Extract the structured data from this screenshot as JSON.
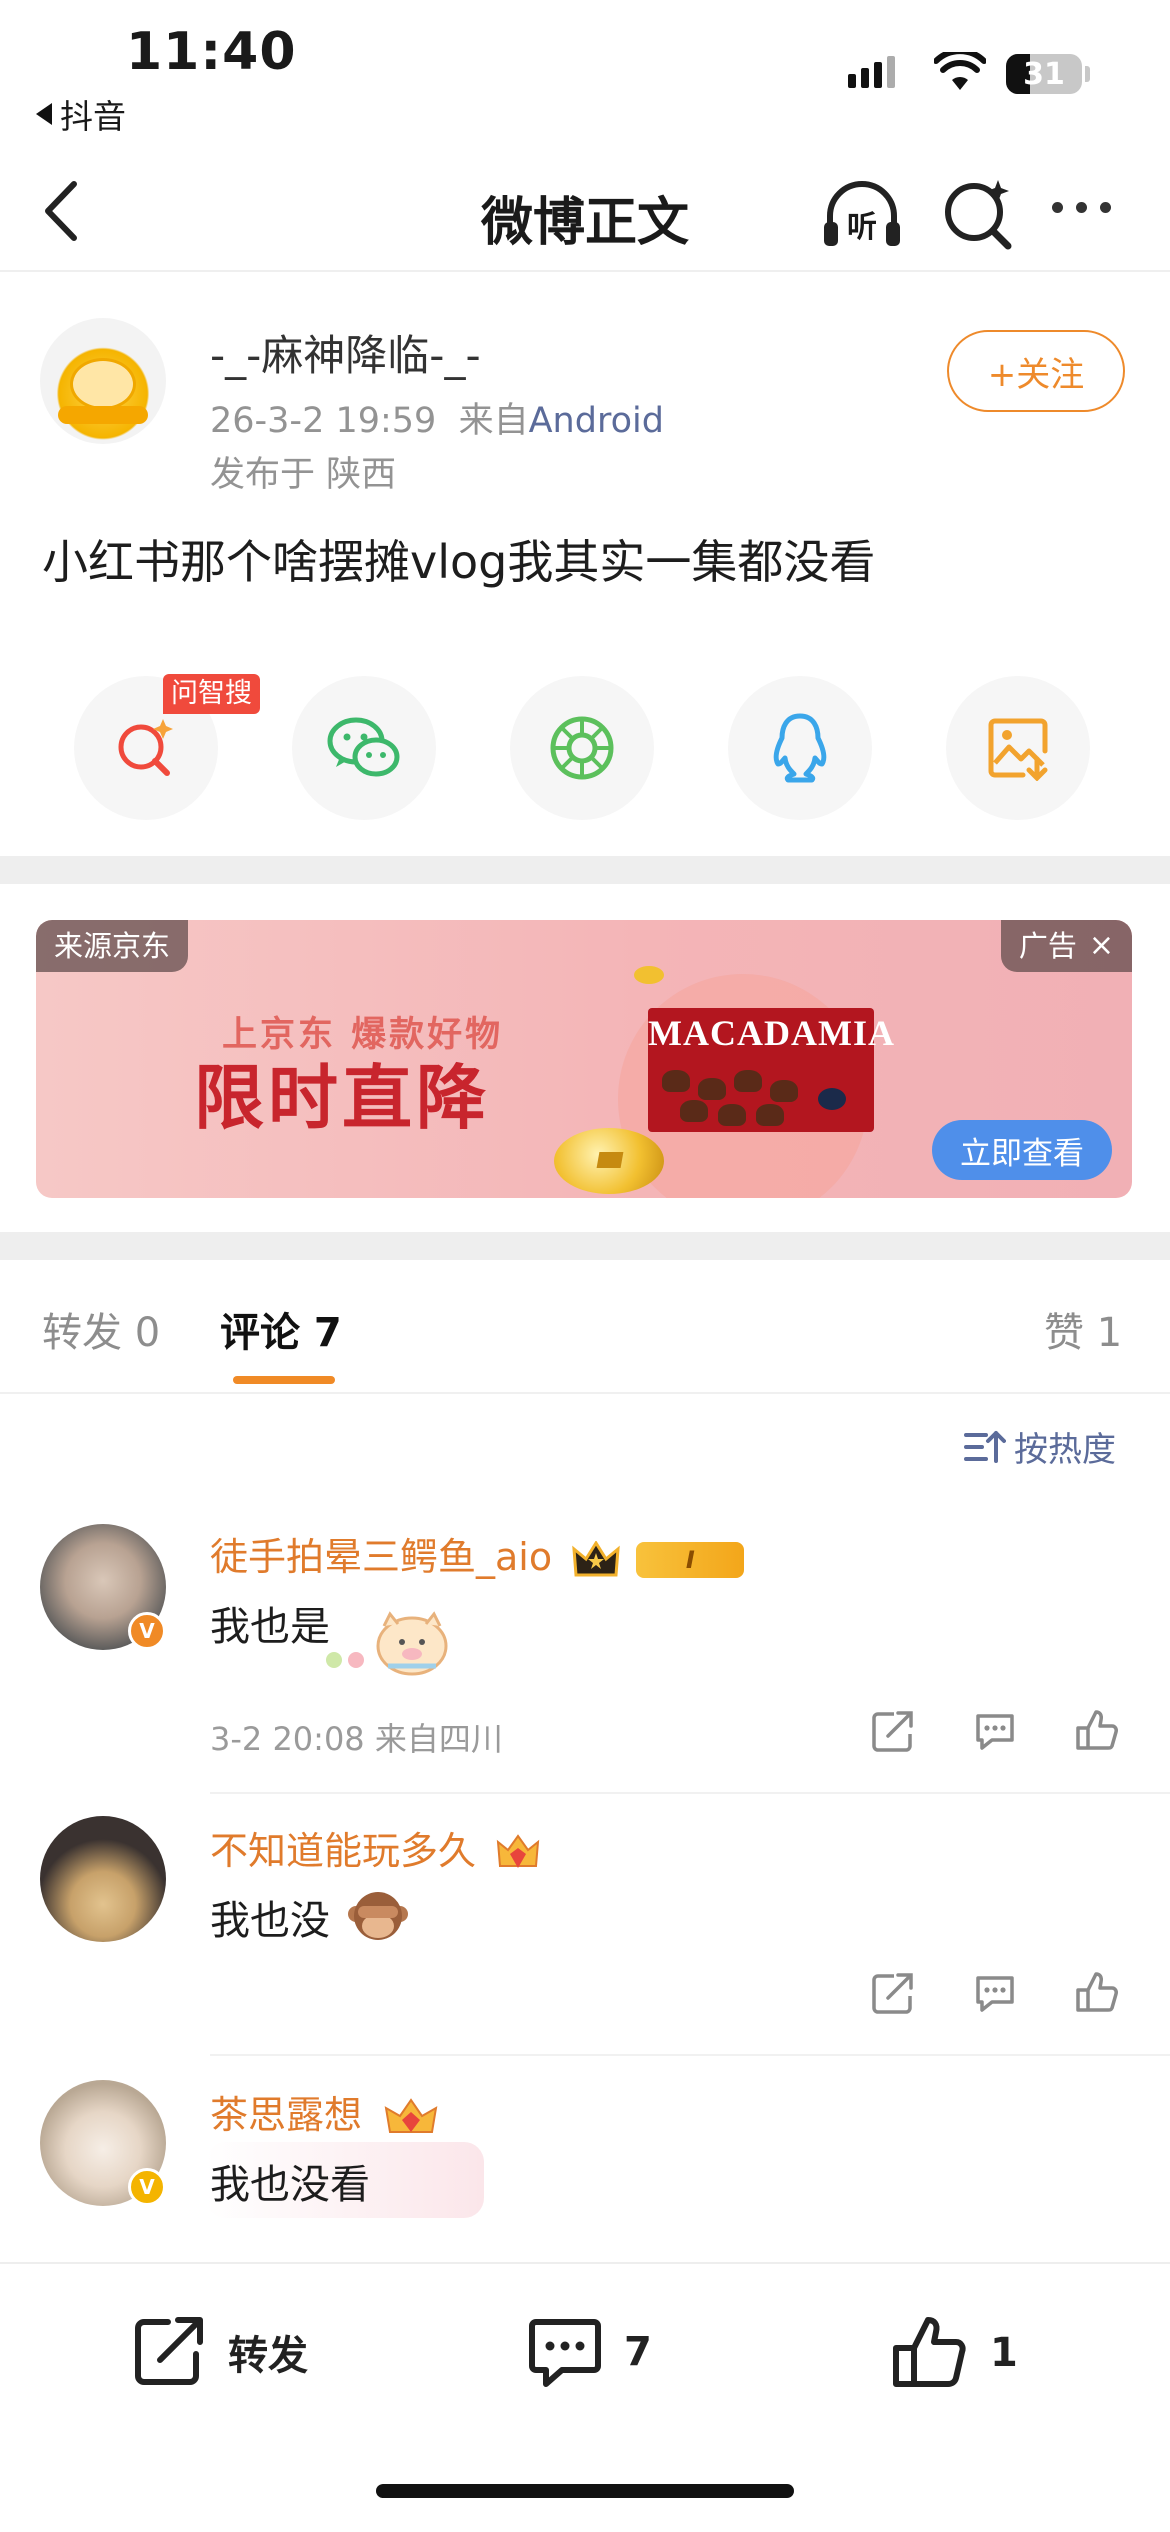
{
  "status_bar": {
    "time": "11:40",
    "back_app": "抖音",
    "battery": "31",
    "battery_level": 0.31
  },
  "nav": {
    "title": "微博正文",
    "listen_label": "听"
  },
  "post": {
    "author": "-_-麻神降临-_-",
    "time": "26-3-2 19:59",
    "from_prefix": "来自",
    "source": "Android",
    "location": "发布于 陕西",
    "follow_label": "+关注",
    "text": "小红书那个啥摆摊vlog我其实一集都没看",
    "ai_badge": "问智搜"
  },
  "share_icons": [
    "ai-search-icon",
    "wechat-icon",
    "moments-icon",
    "qq-icon",
    "save-image-icon"
  ],
  "ad": {
    "source_tag": "来源京东",
    "ad_label": "广告",
    "headline_sub": "上京东 爆款好物",
    "headline_main": "限时直降",
    "product": "MACADAMIA",
    "cta": "立即查看"
  },
  "tabs": [
    {
      "label": "转发 0"
    },
    {
      "label": "评论 7"
    },
    {
      "label": "赞 1"
    }
  ],
  "sort_label": "按热度",
  "comments": [
    {
      "name": "徒手拍晕三鳄鱼_aio",
      "text": "我也是",
      "meta": "3-2 20:08 来自四川",
      "badge": "I"
    },
    {
      "name": "不知道能玩多久",
      "text": "我也没",
      "meta": ""
    },
    {
      "name": "茶思露想",
      "text": "我也没看",
      "meta": ""
    }
  ],
  "bottom_bar": {
    "repost": "转发",
    "comments": "7",
    "likes": "1"
  },
  "colors": {
    "accent": "#EE8A2B",
    "link": "#5B6B9A",
    "username": "#E07B2C",
    "ad_cta": "#4F8FEA"
  }
}
